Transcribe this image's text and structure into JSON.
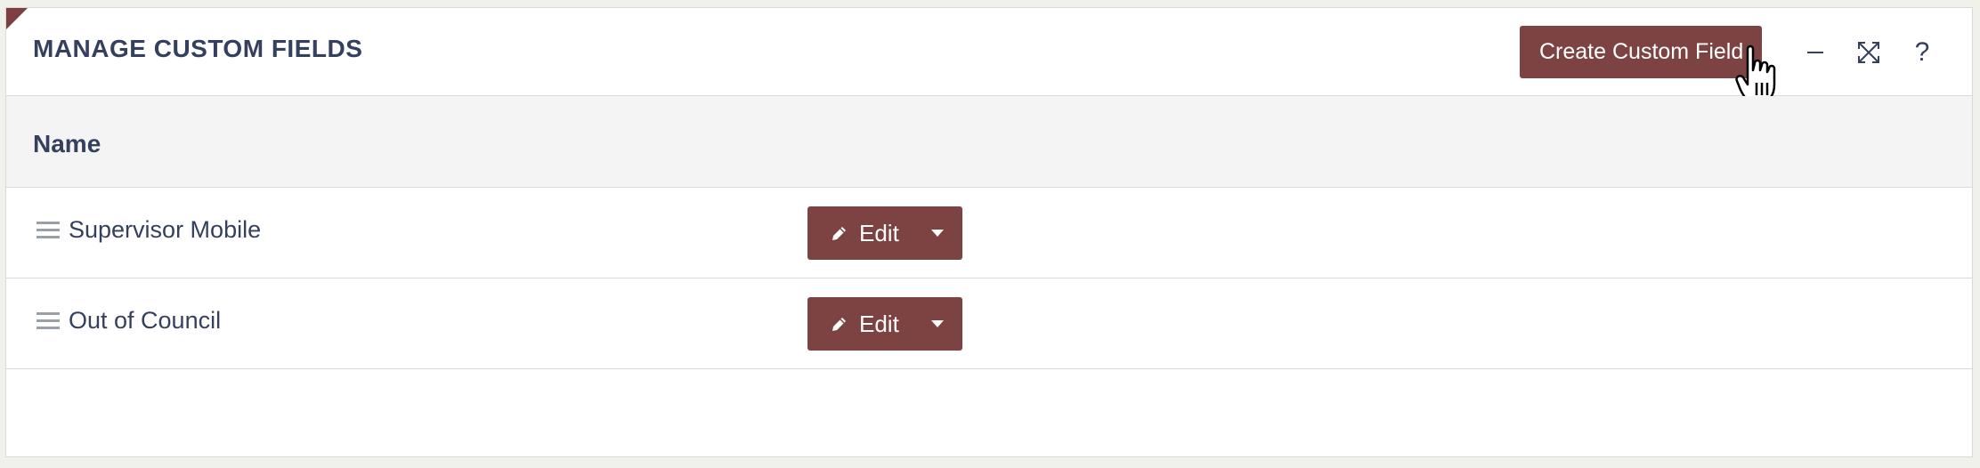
{
  "panel": {
    "title": "MANAGE CUSTOM FIELDS",
    "create_button_label": "Create Custom Field",
    "help_label": "?"
  },
  "table": {
    "columns": [
      "Name"
    ],
    "rows": [
      {
        "name": "Supervisor Mobile",
        "edit_label": "Edit"
      },
      {
        "name": "Out of Council",
        "edit_label": "Edit"
      }
    ]
  },
  "colors": {
    "accent": "#7d4343",
    "text": "#34405e",
    "header_bg": "#f4f4f4"
  },
  "icons": [
    "minimize-icon",
    "expand-icon",
    "help-icon",
    "drag-handle-icon",
    "pencil-icon",
    "caret-down-icon",
    "hand-cursor-icon"
  ]
}
